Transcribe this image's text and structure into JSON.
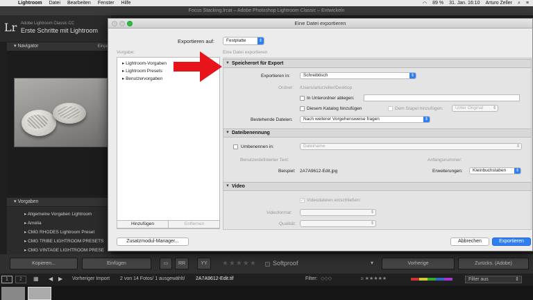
{
  "menubar": {
    "app": "Lightroom",
    "items": [
      "Datei",
      "Bearbeiten",
      "Fenster",
      "Hilfe"
    ],
    "battery": "89 %",
    "date": "31. Jan. 16:10",
    "user": "Arturo Zeller"
  },
  "lr": {
    "window_title": "Focus Stacking.lrcat – Adobe Photoshop Lightroom Classic – Entwickeln",
    "logo": "Lr",
    "product": "Adobe Lightroom Classic CC",
    "catalog": "Erste Schritte mit Lightroom",
    "navigator": "Navigator",
    "navigator_mode": "Einpa",
    "vorgaben": "Vorgaben",
    "presets": [
      "Allgemeine Vorgaben Lightroom",
      "Amelia",
      "CMG RHODES Lightroom Preset",
      "CMG TRIBE LIGHTROOM PRESETS",
      "CMG VINTAGE LIGHTROOM PRESE"
    ]
  },
  "toolbar": {
    "kopieren": "Kopieren...",
    "einfuegen": "Einfügen",
    "softproof": "Softproof",
    "vorherige": "Vorherige",
    "zuruecks": "Zurücks. (Adobe)"
  },
  "filmstrip": {
    "page1": "1",
    "page2": "2",
    "source": "Vorheriger Import",
    "count": "2 von 14 Fotos/ 1 ausgewählt/",
    "filename": "2A7A9612-Edit.tif",
    "filter_label": "Filter:",
    "filter_value": "Filter aus"
  },
  "dialog": {
    "title": "Eine Datei exportieren",
    "export_to_label": "Exportieren auf:",
    "export_to_value": "Festplatte",
    "vorgabe_label": "Vorgabe:",
    "content_label": "Eine Datei exportieren",
    "tree": [
      "Lightroom-Vorgaben",
      "Lightroom Presets",
      "Benutzervorgaben"
    ],
    "add_button": "Hinzufügen",
    "remove_button": "Entfernen",
    "plugin_button": "Zusatzmodul-Manager...",
    "cancel_button": "Abbrechen",
    "export_button": "Exportieren",
    "sections": {
      "location": {
        "title": "Speicherort für Export",
        "export_in_label": "Exportieren in:",
        "export_in_value": "Schreibtisch",
        "folder_label": "Ordner:",
        "folder_value": "/Users/arturzeller/Desktop",
        "subfolder_label": "In Unterordner ablegen:",
        "catalog_label": "Diesem Katalog hinzufügen",
        "stack_label": "Dem Stapel hinzufügen:",
        "stack_value": "Unter Original",
        "existing_label": "Bestehende Dateien:",
        "existing_value": "Nach weiterer Vorgehensweise fragen"
      },
      "naming": {
        "title": "Dateibenennung",
        "rename_label": "Umbenennen in:",
        "rename_value": "Dateiname",
        "custom_text_label": "Benutzerdefinierter Text:",
        "start_number_label": "Anfangsnummer:",
        "example_label": "Beispiel:",
        "example_value": "2A7A9612-Edit.jpg",
        "extensions_label": "Erweiterungen:",
        "extensions_value": "Kleinbuchstaben"
      },
      "video": {
        "title": "Video",
        "include_label": "Videodateien einschließen:",
        "format_label": "Videoformat:",
        "quality_label": "Qualität:"
      }
    }
  },
  "colors": {
    "accent": "#2f7ff0",
    "arrow": "#e8141c",
    "traffic_green": "#2dbd43"
  }
}
